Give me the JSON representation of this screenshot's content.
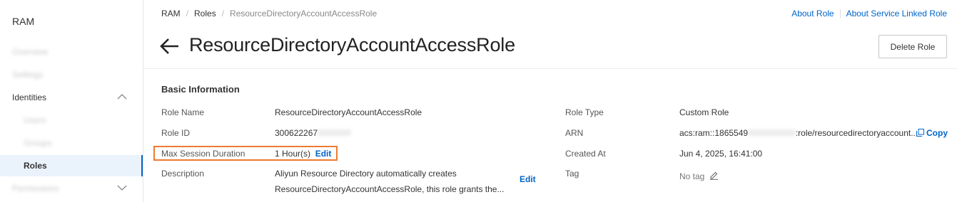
{
  "sidebar": {
    "title": "RAM",
    "items": [
      {
        "label": "Overview"
      },
      {
        "label": "Settings"
      },
      {
        "label": "Identities"
      },
      {
        "label": "Users"
      },
      {
        "label": "Groups"
      },
      {
        "label": "Roles"
      },
      {
        "label": "Permissions"
      }
    ]
  },
  "breadcrumb": {
    "items": [
      "RAM",
      "Roles",
      "ResourceDirectoryAccountAccessRole"
    ]
  },
  "links": {
    "about_role": "About Role",
    "about_service_linked_role": "About Service Linked Role"
  },
  "header": {
    "title": "ResourceDirectoryAccountAccessRole",
    "delete_button": "Delete Role"
  },
  "basic_info": {
    "section_title": "Basic Information",
    "role_name_label": "Role Name",
    "role_name": "ResourceDirectoryAccountAccessRole",
    "role_id_label": "Role ID",
    "role_id_prefix": "300622267",
    "role_id_masked": "0000000",
    "max_session_label": "Max Session Duration",
    "max_session_value": "1 Hour(s)",
    "edit_label": "Edit",
    "description_label": "Description",
    "description_line1": "Aliyun Resource Directory automatically creates",
    "description_line2": "ResourceDirectoryAccountAccessRole, this role grants the...",
    "description_edit": "Edit",
    "role_type_label": "Role Type",
    "role_type": "Custom Role",
    "arn_label": "ARN",
    "arn_prefix": "acs:ram::1865549",
    "arn_masked": "0000000000",
    "arn_suffix": ":role/resourcedirectoryaccount...",
    "copy_label": "Copy",
    "created_at_label": "Created At",
    "created_at": "Jun 4, 2025, 16:41:00",
    "tag_label": "Tag",
    "tag_value": "No tag"
  },
  "colors": {
    "accent": "#0064c8",
    "highlight": "#ee7b30"
  }
}
